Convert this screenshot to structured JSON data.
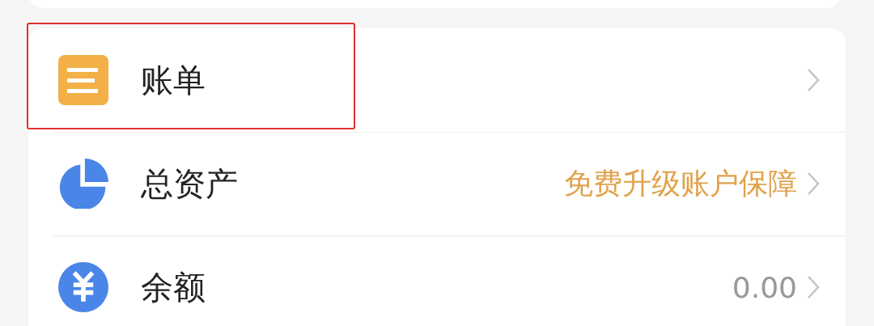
{
  "menu": {
    "rows": [
      {
        "kind": "bill",
        "label": "账单",
        "highlighted": true
      },
      {
        "kind": "pie",
        "label": "总资产",
        "value": {
          "text": "免费升级账户保障",
          "emphasis": true
        },
        "highlighted": false
      },
      {
        "kind": "yuan",
        "label": "余额",
        "value": {
          "text": "0.00",
          "emphasis": false
        },
        "highlighted": false
      }
    ]
  }
}
